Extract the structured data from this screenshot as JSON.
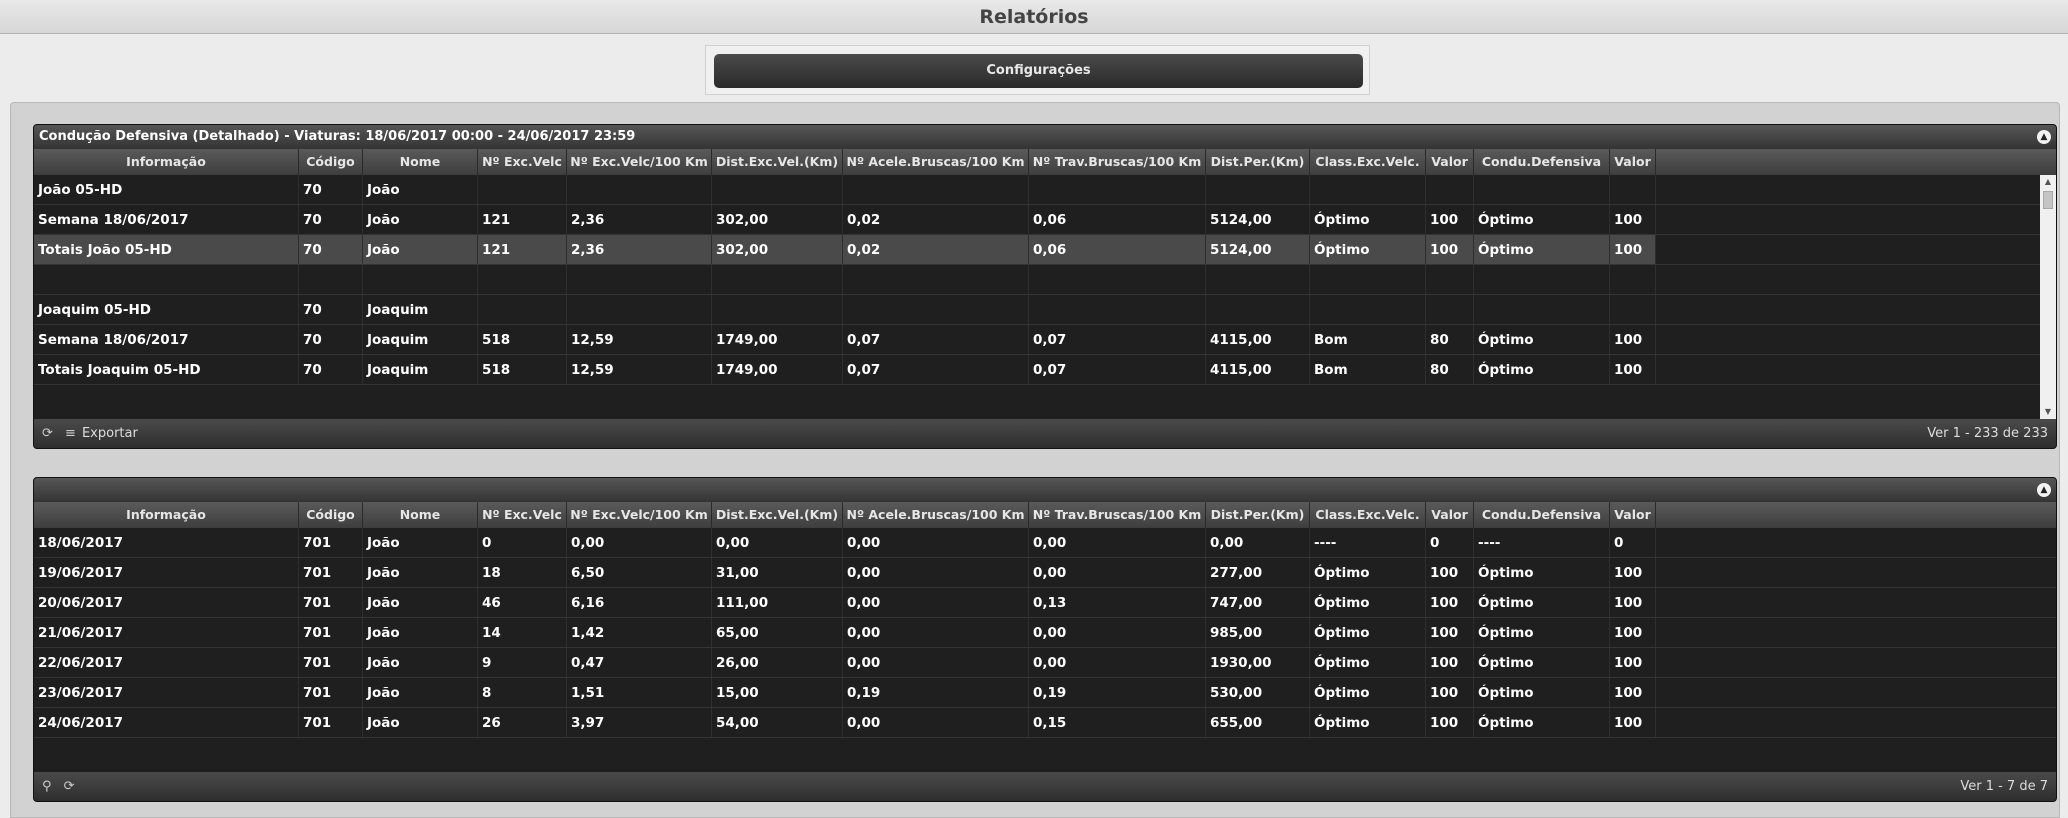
{
  "title": "Relatórios",
  "config_button": "Configurações",
  "columns": [
    "Informação",
    "Código",
    "Nome",
    "Nº Exc.Velc",
    "Nº Exc.Velc/100 Km",
    "Dist.Exc.Vel.(Km)",
    "Nº Acele.Bruscas/100 Km",
    "Nº Trav.Bruscas/100 Km",
    "Dist.Per.(Km)",
    "Class.Exc.Velc.",
    "Valor",
    "Condu.Defensiva",
    "Valor"
  ],
  "panel1": {
    "title": "Condução Defensiva (Detalhado) - Viaturas: 18/06/2017 00:00 - 24/06/2017 23:59",
    "rows": [
      [
        "João 05-HD",
        "70",
        "João",
        "",
        "",
        "",
        "",
        "",
        "",
        "",
        "",
        "",
        ""
      ],
      [
        "Semana 18/06/2017",
        "70",
        "João",
        "121",
        "2,36",
        "302,00",
        "0,02",
        "0,06",
        "5124,00",
        "Óptimo",
        "100",
        "Óptimo",
        "100"
      ],
      [
        "Totais João 05-HD",
        "70",
        "João",
        "121",
        "2,36",
        "302,00",
        "0,02",
        "0,06",
        "5124,00",
        "Óptimo",
        "100",
        "Óptimo",
        "100"
      ],
      [
        "",
        "",
        "",
        "",
        "",
        "",
        "",
        "",
        "",
        "",
        "",
        "",
        ""
      ],
      [
        "Joaquim 05-HD",
        "70",
        "Joaquim",
        "",
        "",
        "",
        "",
        "",
        "",
        "",
        "",
        "",
        ""
      ],
      [
        "Semana 18/06/2017",
        "70",
        "Joaquim",
        "518",
        "12,59",
        "1749,00",
        "0,07",
        "0,07",
        "4115,00",
        "Bom",
        "80",
        "Óptimo",
        "100"
      ],
      [
        "Totais Joaquim 05-HD",
        "70",
        "Joaquim",
        "518",
        "12,59",
        "1749,00",
        "0,07",
        "0,07",
        "4115,00",
        "Bom",
        "80",
        "Óptimo",
        "100"
      ]
    ],
    "footer_export": "Exportar",
    "pager": "Ver 1 - 233 de 233"
  },
  "panel2": {
    "title": "",
    "rows": [
      [
        "18/06/2017",
        "701",
        "João",
        "0",
        "0,00",
        "0,00",
        "0,00",
        "0,00",
        "0,00",
        "----",
        "0",
        "----",
        "0"
      ],
      [
        "19/06/2017",
        "701",
        "João",
        "18",
        "6,50",
        "31,00",
        "0,00",
        "0,00",
        "277,00",
        "Óptimo",
        "100",
        "Óptimo",
        "100"
      ],
      [
        "20/06/2017",
        "701",
        "João",
        "46",
        "6,16",
        "111,00",
        "0,00",
        "0,13",
        "747,00",
        "Óptimo",
        "100",
        "Óptimo",
        "100"
      ],
      [
        "21/06/2017",
        "701",
        "João",
        "14",
        "1,42",
        "65,00",
        "0,00",
        "0,00",
        "985,00",
        "Óptimo",
        "100",
        "Óptimo",
        "100"
      ],
      [
        "22/06/2017",
        "701",
        "João",
        "9",
        "0,47",
        "26,00",
        "0,00",
        "0,00",
        "1930,00",
        "Óptimo",
        "100",
        "Óptimo",
        "100"
      ],
      [
        "23/06/2017",
        "701",
        "João",
        "8",
        "1,51",
        "15,00",
        "0,19",
        "0,19",
        "530,00",
        "Óptimo",
        "100",
        "Óptimo",
        "100"
      ],
      [
        "24/06/2017",
        "701",
        "João",
        "26",
        "3,97",
        "54,00",
        "0,00",
        "0,15",
        "655,00",
        "Óptimo",
        "100",
        "Óptimo",
        "100"
      ]
    ],
    "pager": "Ver 1 - 7 de 7"
  },
  "icons": {
    "collapse": "chevron-up-icon",
    "refresh": "refresh-icon",
    "export": "export-icon",
    "search": "search-icon"
  }
}
